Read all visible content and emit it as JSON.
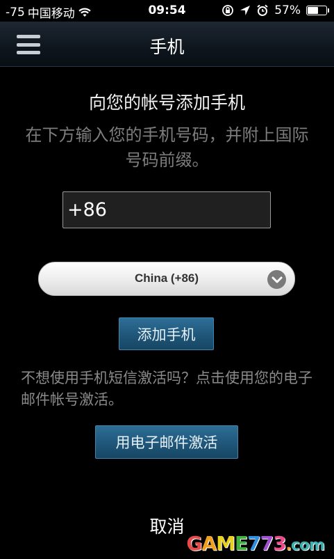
{
  "status_bar": {
    "signal": "-75",
    "carrier": "中国移动",
    "time": "09:54",
    "battery_percent_label": "57%",
    "battery_level": 0.57
  },
  "nav": {
    "title": "手机"
  },
  "content": {
    "heading": "向您的帐号添加手机",
    "instructions": "在下方输入您的手机号码，并附上国际号码前缀。",
    "phone_value": "+86",
    "country_selected": "China (+86)",
    "add_phone_label": "添加手机",
    "alt_text": "不想使用手机短信激活吗？点击使用您的电子邮件帐号激活。",
    "email_activate_label": "用电子邮件激活",
    "cancel_label": "取消"
  },
  "watermark": {
    "text": "GAME773.com"
  },
  "colors": {
    "background": "#000000",
    "button_blue": "#1f5679",
    "muted_text": "#7d7d7d"
  },
  "icons": [
    "wifi-icon",
    "orientation-lock-icon",
    "location-arrow-icon",
    "alarm-icon",
    "battery-icon",
    "menu-icon",
    "chevron-down-icon"
  ]
}
